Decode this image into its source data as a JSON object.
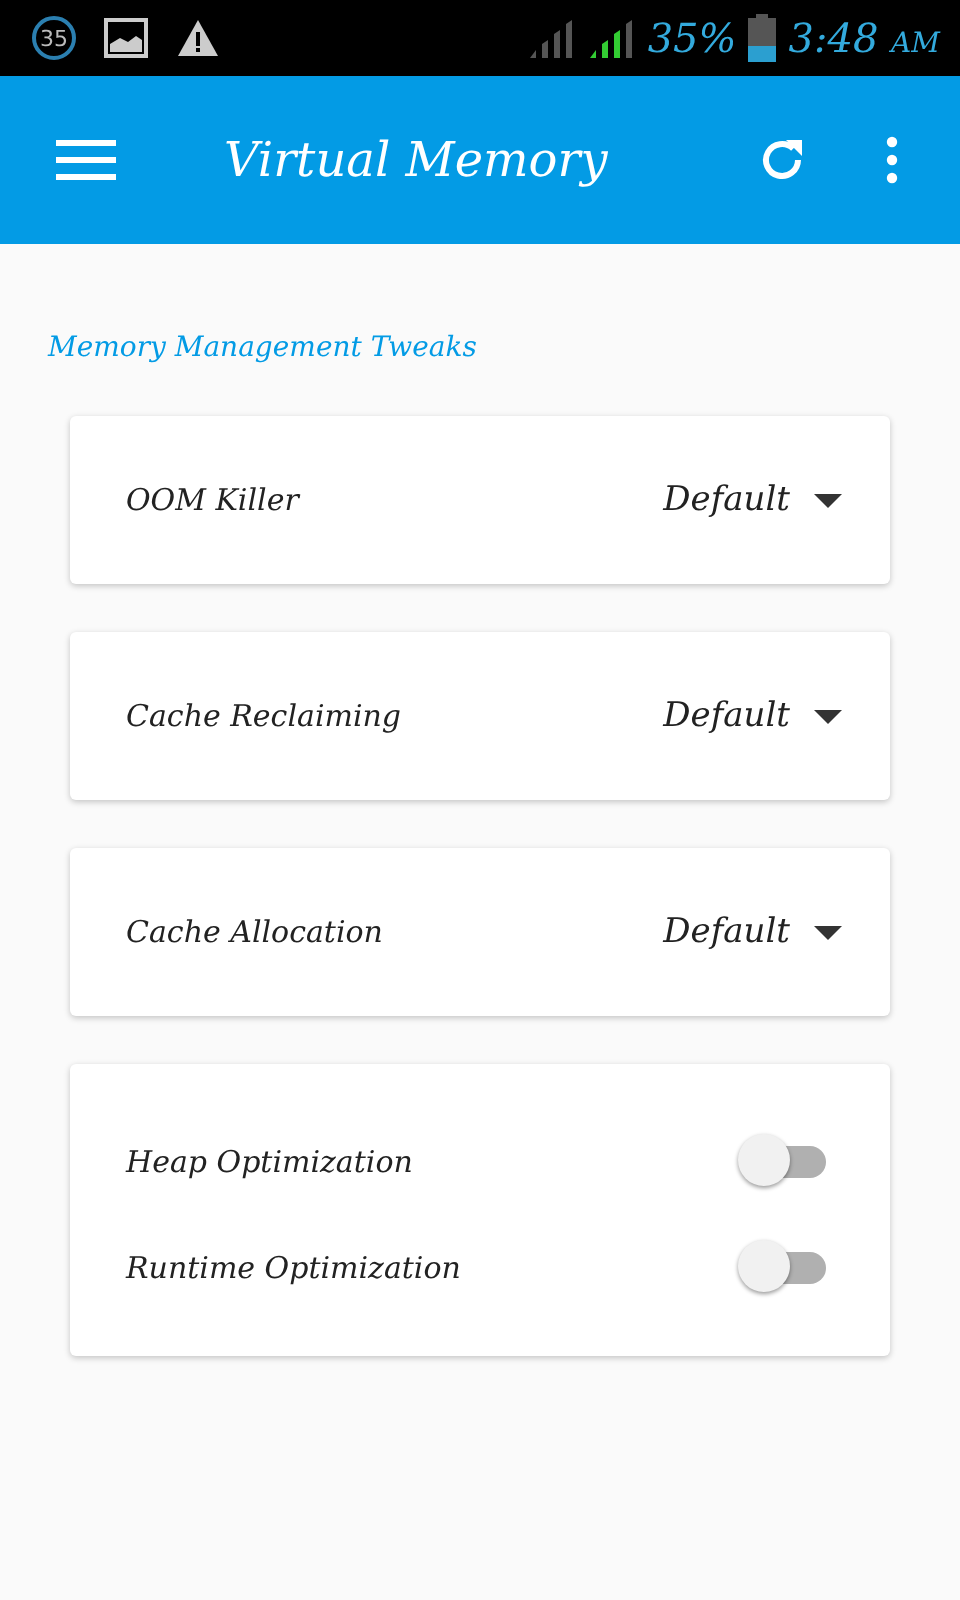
{
  "status_bar": {
    "badge": "35",
    "battery": "35%",
    "time": "3:48",
    "meridiem": "AM"
  },
  "app_bar": {
    "title": "Virtual Memory"
  },
  "section": {
    "title": "Memory Management Tweaks"
  },
  "dropdowns": [
    {
      "label": "OOM Killer",
      "value": "Default"
    },
    {
      "label": "Cache Reclaiming",
      "value": "Default"
    },
    {
      "label": "Cache Allocation",
      "value": "Default"
    }
  ],
  "toggles": [
    {
      "label": "Heap Optimization",
      "on": false
    },
    {
      "label": "Runtime Optimization",
      "on": false
    }
  ]
}
